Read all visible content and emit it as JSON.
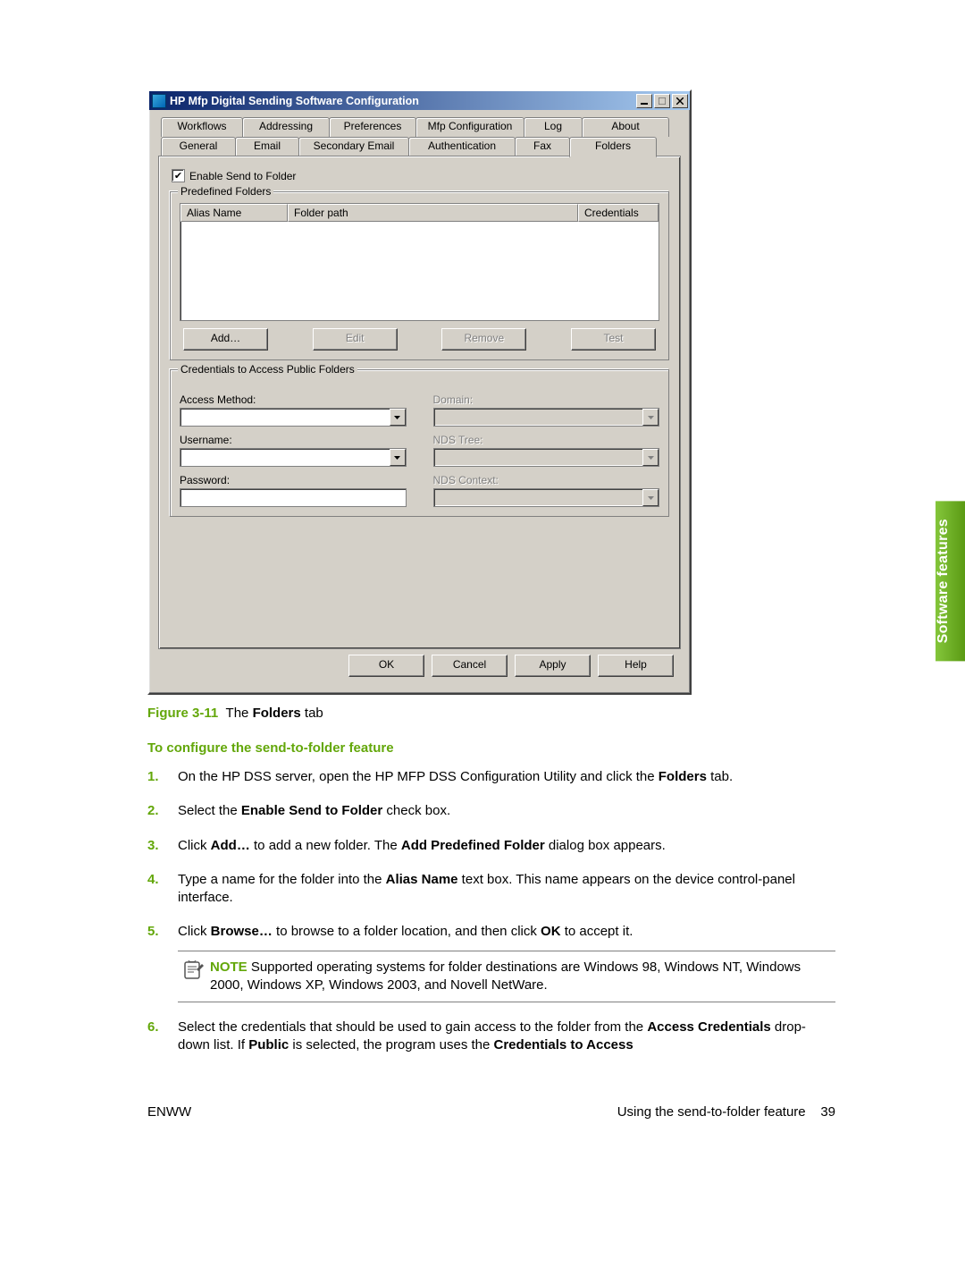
{
  "sideTab": "Software features",
  "dialog": {
    "title": "HP Mfp Digital Sending Software Configuration",
    "tabsRow1": [
      "Workflows",
      "Addressing",
      "Preferences",
      "Mfp Configuration",
      "Log",
      "About"
    ],
    "tabsRow2": [
      "General",
      "Email",
      "Secondary Email",
      "Authentication",
      "Fax",
      "Folders"
    ],
    "activeTab": "Folders",
    "enableCheckbox": "Enable Send to Folder",
    "group1": {
      "legend": "Predefined Folders",
      "columns": [
        "Alias Name",
        "Folder path",
        "Credentials"
      ],
      "buttons": {
        "add": "Add…",
        "edit": "Edit",
        "remove": "Remove",
        "test": "Test"
      }
    },
    "group2": {
      "legend": "Credentials to Access Public Folders",
      "left": {
        "accessMethod": "Access Method:",
        "username": "Username:",
        "password": "Password:"
      },
      "right": {
        "domain": "Domain:",
        "ndsTree": "NDS Tree:",
        "ndsContext": "NDS Context:"
      }
    },
    "buttons": {
      "ok": "OK",
      "cancel": "Cancel",
      "apply": "Apply",
      "help": "Help"
    }
  },
  "caption": {
    "fig": "Figure 3-11",
    "text": "The ",
    "bold": "Folders",
    "text2": " tab"
  },
  "heading": "To configure the send-to-folder feature",
  "steps": {
    "s1a": "On the HP DSS server, open the HP MFP DSS Configuration Utility and click the ",
    "s1b": "Folders",
    "s1c": " tab.",
    "s2a": "Select the ",
    "s2b": "Enable Send to Folder",
    "s2c": " check box.",
    "s3a": "Click ",
    "s3b": "Add…",
    "s3c": " to add a new folder. The ",
    "s3d": "Add Predefined Folder",
    "s3e": " dialog box appears.",
    "s4a": "Type a name for the folder into the ",
    "s4b": "Alias Name",
    "s4c": " text box. This name appears on the device control-panel interface.",
    "s5a": "Click ",
    "s5b": "Browse…",
    "s5c": " to browse to a folder location, and then click ",
    "s5d": "OK",
    "s5e": " to accept it.",
    "s6a": "Select the credentials that should be used to gain access to the folder from the ",
    "s6b": "Access Credentials",
    "s6c": " drop-down list. If ",
    "s6d": "Public",
    "s6e": " is selected, the program uses the ",
    "s6f": "Credentials to Access"
  },
  "note": {
    "lead": "NOTE",
    "body": "   Supported operating systems for folder destinations are Windows 98, Windows NT, Windows 2000, Windows XP, Windows 2003, and Novell NetWare."
  },
  "footer": {
    "left": "ENWW",
    "rightText": "Using the send-to-folder feature",
    "page": "39"
  }
}
